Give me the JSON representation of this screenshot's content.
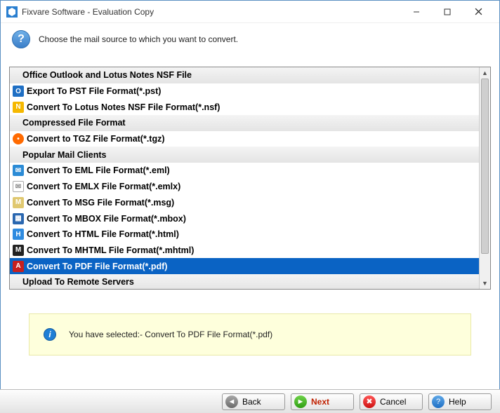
{
  "window": {
    "title": "Fixvare Software - Evaluation Copy"
  },
  "header": {
    "prompt": "Choose the mail source to which you want to convert."
  },
  "list": {
    "section0": "Office Outlook and Lotus Notes NSF File",
    "items0": [
      {
        "label": "Export To PST File Format(*.pst)"
      },
      {
        "label": "Convert To Lotus Notes NSF File Format(*.nsf)"
      }
    ],
    "section1": "Compressed File Format",
    "items1": [
      {
        "label": "Convert to TGZ File Format(*.tgz)"
      }
    ],
    "section2": "Popular Mail Clients",
    "items2": [
      {
        "label": "Convert To EML File Format(*.eml)"
      },
      {
        "label": "Convert To EMLX File Format(*.emlx)"
      },
      {
        "label": "Convert To MSG File Format(*.msg)"
      },
      {
        "label": "Convert To MBOX File Format(*.mbox)"
      },
      {
        "label": "Convert To HTML File Format(*.html)"
      },
      {
        "label": "Convert To MHTML File Format(*.mhtml)"
      },
      {
        "label": "Convert To PDF File Format(*.pdf)"
      }
    ],
    "section3": "Upload To Remote Servers",
    "selected": "Convert To PDF File Format(*.pdf)"
  },
  "info": {
    "text": "You have selected:- Convert To PDF File Format(*.pdf)"
  },
  "footer": {
    "back": "Back",
    "next": "Next",
    "cancel": "Cancel",
    "help": "Help"
  }
}
